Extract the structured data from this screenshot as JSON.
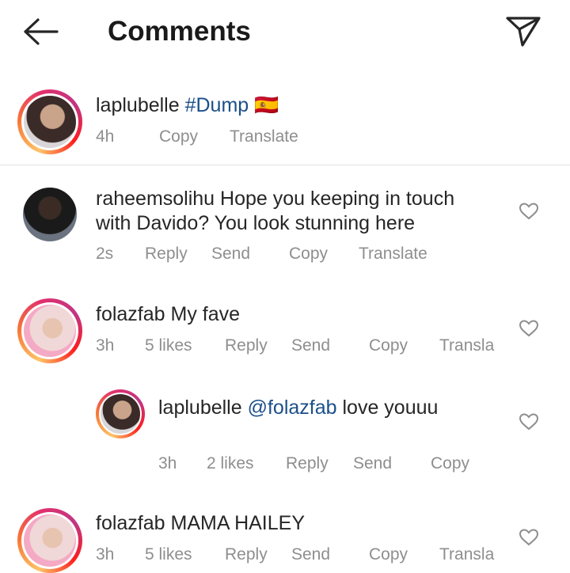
{
  "header": {
    "title": "Comments"
  },
  "caption": {
    "username": "laplubelle",
    "text": "#Dump",
    "flag": "🇪🇸",
    "time": "4h",
    "copy": "Copy",
    "translate": "Translate"
  },
  "comments": [
    {
      "username": "raheemsolihu",
      "text_line1": "Hope you keeping in touch",
      "text_line2": "with Davido? You look stunning here",
      "time": "2s",
      "reply": "Reply",
      "send": "Send",
      "copy": "Copy",
      "translate": "Translate"
    },
    {
      "username": "folazfab",
      "text": "My fave",
      "time": "3h",
      "likes": "5 likes",
      "reply": "Reply",
      "send": "Send",
      "copy": "Copy",
      "translate": "Transla"
    },
    {
      "username": "laplubelle",
      "mention": "@folazfab",
      "text": "love youuu",
      "time": "3h",
      "likes": "2 likes",
      "reply": "Reply",
      "send": "Send",
      "copy": "Copy"
    },
    {
      "username": "folazfab",
      "text": "MAMA HAILEY",
      "time": "3h",
      "likes": "5 likes",
      "reply": "Reply",
      "send": "Send",
      "copy": "Copy",
      "translate": "Transla"
    }
  ],
  "colors": {
    "link": "#1b4f8a",
    "meta": "#8e8e8e",
    "text": "#262626"
  },
  "icons": [
    "back-arrow-icon",
    "direct-send-icon",
    "heart-icon"
  ]
}
